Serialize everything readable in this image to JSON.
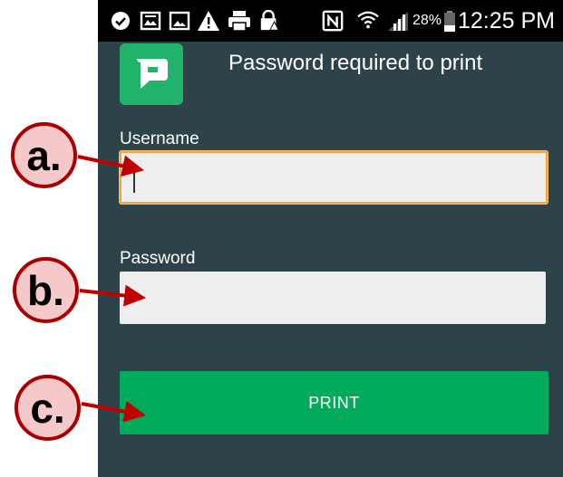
{
  "status_bar": {
    "icons": [
      "checkmark-circle-icon",
      "image-icon",
      "photo-icon",
      "warning-icon",
      "print-icon",
      "lock-icon",
      "nfc-icon",
      "wifi-icon",
      "signal-icon",
      "battery-icon"
    ],
    "battery_percent": "28%",
    "time": "12:25 PM"
  },
  "dialog": {
    "title": "Password required to print",
    "logo_icon": "papercut-logo-icon",
    "brand_color": "#22b36a"
  },
  "form": {
    "username_label": "Username",
    "username_value": "",
    "password_label": "Password",
    "password_value": "",
    "print_label": "PRINT"
  },
  "annotations": {
    "a": "a.",
    "b": "b.",
    "c": "c."
  },
  "colors": {
    "background": "#2e4349",
    "focus_border": "#f0a442",
    "button": "#00ab5b",
    "callout_fill": "#f5c9c9",
    "callout_border": "#a80000"
  }
}
